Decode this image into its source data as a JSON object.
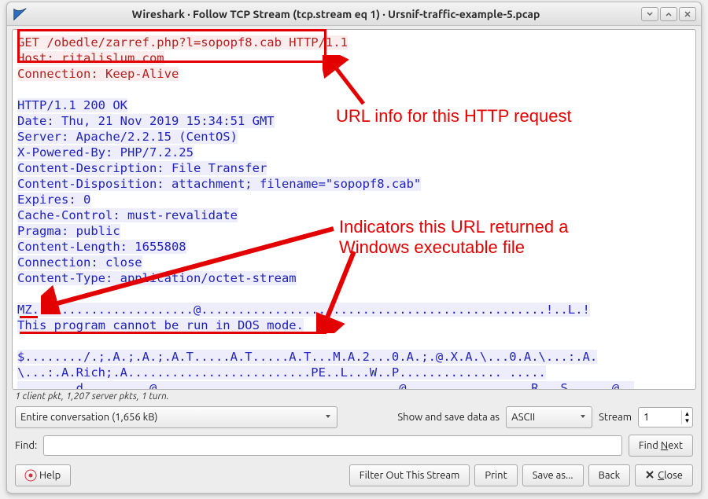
{
  "window": {
    "title": "Wireshark · Follow TCP Stream (tcp.stream eq 1) · Ursnif-traffic-example-5.pcap"
  },
  "stream": {
    "req_line": "GET /obedle/zarref.php?l=sopopf8.cab HTTP/1.1",
    "host_line": "Host: ritalislum.com",
    "conn_line": "Connection: Keep-Alive",
    "blank1": "",
    "resp_status": "HTTP/1.1 200 OK",
    "resp_date": "Date: Thu, 21 Nov 2019 15:34:51 GMT",
    "resp_server": "Server: Apache/2.2.15 (CentOS)",
    "resp_xpb": "X-Powered-By: PHP/7.2.25",
    "resp_cd": "Content-Description: File Transfer",
    "resp_cdisp": "Content-Disposition: attachment; filename=\"sopopf8.cab\"",
    "resp_exp": "Expires: 0",
    "resp_cc": "Cache-Control: must-revalidate",
    "resp_pragma": "Pragma: public",
    "resp_clen": "Content-Length: 1655808",
    "resp_conn": "Connection: close",
    "resp_ctype": "Content-Type: application/octet-stream",
    "blank2": "",
    "mz_line": "MZ......................@...............................................!..L.!",
    "dos_line": "This program cannot be run in DOS mode.",
    "blank3": "",
    "bin1": "$......../.;.A.;.A.;.A.T.....A.T.....A.T...M.A.2...0.A.;.@.X.A.\\...0.A.\\...:.A.",
    "bin2": "\\...:.A.Rich;.A.........................PE..L...W..P.............. .....",
    "bin3": "........d.........@.................................@.................R...S......@.."
  },
  "stats": {
    "prefix_n": "1",
    "client_word": "client",
    "mid": " pkt, 1,207 ",
    "server_word": "server",
    "suffix": " pkts, 1 turn."
  },
  "controls": {
    "conversation_select": "Entire conversation (1,656 kB)",
    "show_save_label": "Show and save data as",
    "encoding_select": "ASCII",
    "stream_label": "Stream",
    "stream_value": "1"
  },
  "find": {
    "label": "Find:",
    "value": "",
    "button": "Find Next",
    "button_u": "N"
  },
  "buttons": {
    "help": "Help",
    "filter": "Filter Out This Stream",
    "print": "Print",
    "saveas": "Save as...",
    "back": "Back",
    "close": "Close"
  },
  "annotations": {
    "a1": "URL info for this HTTP request",
    "a2_l1": "Indicators this URL returned a",
    "a2_l2": "Windows executable file"
  },
  "colors": {
    "annotation": "#e30000",
    "client_fg": "#b22222",
    "server_fg": "#2224b8"
  }
}
